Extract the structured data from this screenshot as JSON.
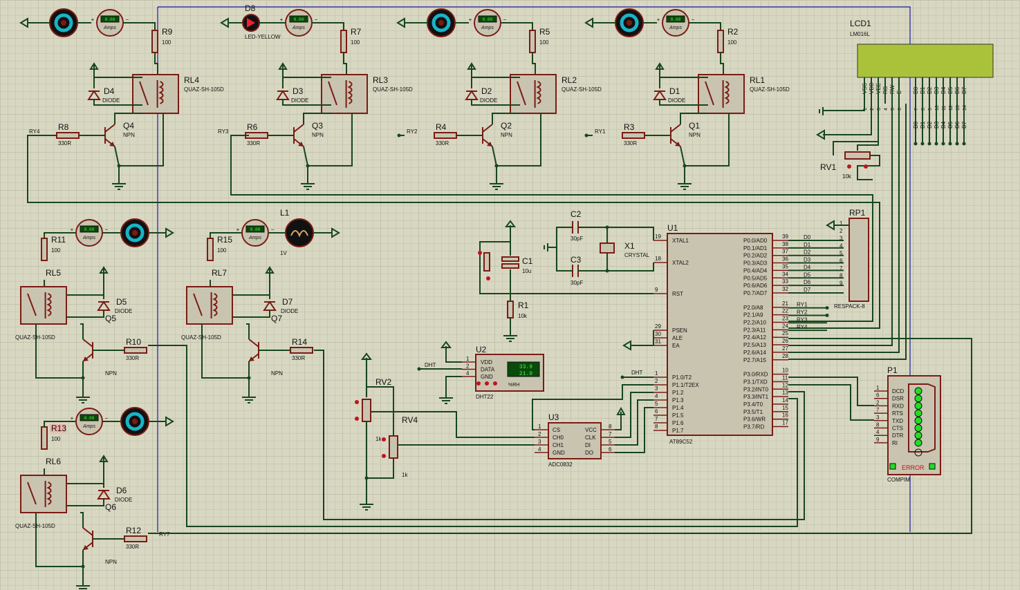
{
  "relays": [
    {
      "id": "RL4",
      "model": "QUAZ-SH-105D"
    },
    {
      "id": "RL3",
      "model": "QUAZ-SH-105D"
    },
    {
      "id": "RL2",
      "model": "QUAZ-SH-105D"
    },
    {
      "id": "RL1",
      "model": "QUAZ-SH-105D"
    },
    {
      "id": "RL5",
      "model": "QUAZ-SH-105D"
    },
    {
      "id": "RL7",
      "model": "QUAZ-SH-105D"
    },
    {
      "id": "RL6",
      "model": "QUAZ-SH-105D"
    }
  ],
  "transistors": [
    {
      "id": "Q4",
      "type": "NPN"
    },
    {
      "id": "Q3",
      "type": "NPN"
    },
    {
      "id": "Q2",
      "type": "NPN"
    },
    {
      "id": "Q1",
      "type": "NPN"
    },
    {
      "id": "Q5",
      "type": "NPN"
    },
    {
      "id": "Q7",
      "type": "NPN"
    },
    {
      "id": "Q6",
      "type": "NPN"
    }
  ],
  "diodes": [
    {
      "id": "D4",
      "type": "DIODE"
    },
    {
      "id": "D3",
      "type": "DIODE"
    },
    {
      "id": "D2",
      "type": "DIODE"
    },
    {
      "id": "D1",
      "type": "DIODE"
    },
    {
      "id": "D5",
      "type": "DIODE"
    },
    {
      "id": "D7",
      "type": "DIODE"
    },
    {
      "id": "D6",
      "type": "DIODE"
    }
  ],
  "load_resistors": [
    {
      "id": "R9",
      "value": "100"
    },
    {
      "id": "R7",
      "value": "100"
    },
    {
      "id": "R5",
      "value": "100"
    },
    {
      "id": "R2",
      "value": "100"
    },
    {
      "id": "R11",
      "value": "100"
    },
    {
      "id": "R15",
      "value": "100"
    },
    {
      "id": "R13",
      "value": "100"
    }
  ],
  "base_resistors": [
    {
      "id": "R8",
      "value": "330R",
      "net": "RY4"
    },
    {
      "id": "R6",
      "value": "330R",
      "net": "RY3"
    },
    {
      "id": "R4",
      "value": "330R",
      "net": "RY2"
    },
    {
      "id": "R3",
      "value": "330R",
      "net": "RY1"
    },
    {
      "id": "R10",
      "value": "330R",
      "net": ""
    },
    {
      "id": "R14",
      "value": "330R",
      "net": ""
    },
    {
      "id": "R12",
      "value": "330R",
      "net": "RY7"
    }
  ],
  "led": {
    "id": "D8",
    "type": "LED-YELLOW"
  },
  "lamp": {
    "id": "L1",
    "value": "1V"
  },
  "ammeter_unit": "Amps",
  "ammeter_reading": "0.00",
  "lcd": {
    "id": "LCD1",
    "model": "LM016L",
    "pins": [
      "VSS",
      "VDD",
      "VEE",
      "RS",
      "RW",
      "E",
      "D0",
      "D1",
      "D2",
      "D3",
      "D4",
      "D5",
      "D6",
      "D7"
    ],
    "pin_numbers": [
      "1",
      "2",
      "3",
      "4",
      "5",
      "6",
      "7",
      "8",
      "9",
      "10",
      "11",
      "12",
      "13",
      "14"
    ]
  },
  "pot_rv1": {
    "id": "RV1",
    "value": "10k"
  },
  "crystal": {
    "id": "X1",
    "type": "CRYSTAL",
    "caps": [
      {
        "id": "C2",
        "value": "30pF"
      },
      {
        "id": "C3",
        "value": "30pF"
      }
    ]
  },
  "reset": {
    "cap": {
      "id": "C1",
      "value": "10u"
    },
    "res": {
      "id": "R1",
      "value": "10k"
    }
  },
  "mcu": {
    "id": "U1",
    "model": "AT89C52",
    "left_pins": [
      [
        "19",
        "XTAL1"
      ],
      [
        "18",
        "XTAL2"
      ],
      [
        "9",
        "RST"
      ],
      [
        "29",
        "PSEN"
      ],
      [
        "30",
        "ALE"
      ],
      [
        "31",
        "EA"
      ],
      [
        "1",
        "P1.0/T2"
      ],
      [
        "2",
        "P1.1/T2EX"
      ],
      [
        "3",
        "P1.2"
      ],
      [
        "4",
        "P1.3"
      ],
      [
        "5",
        "P1.4"
      ],
      [
        "6",
        "P1.5"
      ],
      [
        "7",
        "P1.6"
      ],
      [
        "8",
        "P1.7"
      ]
    ],
    "right_pins": [
      [
        "39",
        "P0.0/AD0"
      ],
      [
        "38",
        "P0.1/AD1"
      ],
      [
        "37",
        "P0.2/AD2"
      ],
      [
        "36",
        "P0.3/AD3"
      ],
      [
        "35",
        "P0.4/AD4"
      ],
      [
        "34",
        "P0.5/AD5"
      ],
      [
        "33",
        "P0.6/AD6"
      ],
      [
        "32",
        "P0.7/AD7"
      ],
      [
        "21",
        "P2.0/A8"
      ],
      [
        "22",
        "P2.1/A9"
      ],
      [
        "23",
        "P2.2/A10"
      ],
      [
        "24",
        "P2.3/A11"
      ],
      [
        "25",
        "P2.4/A12"
      ],
      [
        "26",
        "P2.5/A13"
      ],
      [
        "27",
        "P2.6/A14"
      ],
      [
        "28",
        "P2.7/A15"
      ],
      [
        "10",
        "P3.0/RXD"
      ],
      [
        "11",
        "P3.1/TXD"
      ],
      [
        "12",
        "P3.2/INT0"
      ],
      [
        "13",
        "P3.3/INT1"
      ],
      [
        "14",
        "P3.4/T0"
      ],
      [
        "15",
        "P3.5/T1"
      ],
      [
        "16",
        "P3.6/WR"
      ],
      [
        "17",
        "P3.7/RD"
      ]
    ]
  },
  "data_nets": [
    "D0",
    "D1",
    "D2",
    "D3",
    "D4",
    "D5",
    "D6",
    "D7"
  ],
  "relay_nets": [
    "RY1",
    "RY2",
    "RY3",
    "RY4"
  ],
  "respack": {
    "id": "RP1",
    "model": "RESPACK-8",
    "pins": [
      "1",
      "2",
      "3",
      "4",
      "5",
      "6",
      "7",
      "8",
      "9"
    ]
  },
  "dht": {
    "id": "U2",
    "model": "DHT22",
    "pins": [
      [
        "1",
        "VDD"
      ],
      [
        "2",
        "DATA"
      ],
      [
        "4",
        "GND"
      ]
    ],
    "net": "DHT",
    "temp": "33.9",
    "hum": "21.0",
    "unit": "%RH"
  },
  "adc": {
    "id": "U3",
    "model": "ADC0832",
    "left_pins": [
      [
        "1",
        "CS"
      ],
      [
        "2",
        "CH0"
      ],
      [
        "3",
        "CH1"
      ],
      [
        "4",
        "GND"
      ]
    ],
    "right_pins": [
      [
        "8",
        "VCC"
      ],
      [
        "7",
        "CLK"
      ],
      [
        "5",
        "DI"
      ],
      [
        "6",
        "DO"
      ]
    ]
  },
  "pots": [
    {
      "id": "RV2",
      "value": "1k"
    },
    {
      "id": "RV4",
      "value": "1k"
    }
  ],
  "compim": {
    "id": "P1",
    "model": "COMPIM",
    "pins": [
      [
        "1",
        "DCD"
      ],
      [
        "6",
        "DSR"
      ],
      [
        "2",
        "RXD"
      ],
      [
        "7",
        "RTS"
      ],
      [
        "3",
        "TXD"
      ],
      [
        "8",
        "CTS"
      ],
      [
        "4",
        "DTR"
      ],
      [
        "9",
        "RI"
      ]
    ],
    "status": "ERROR"
  }
}
